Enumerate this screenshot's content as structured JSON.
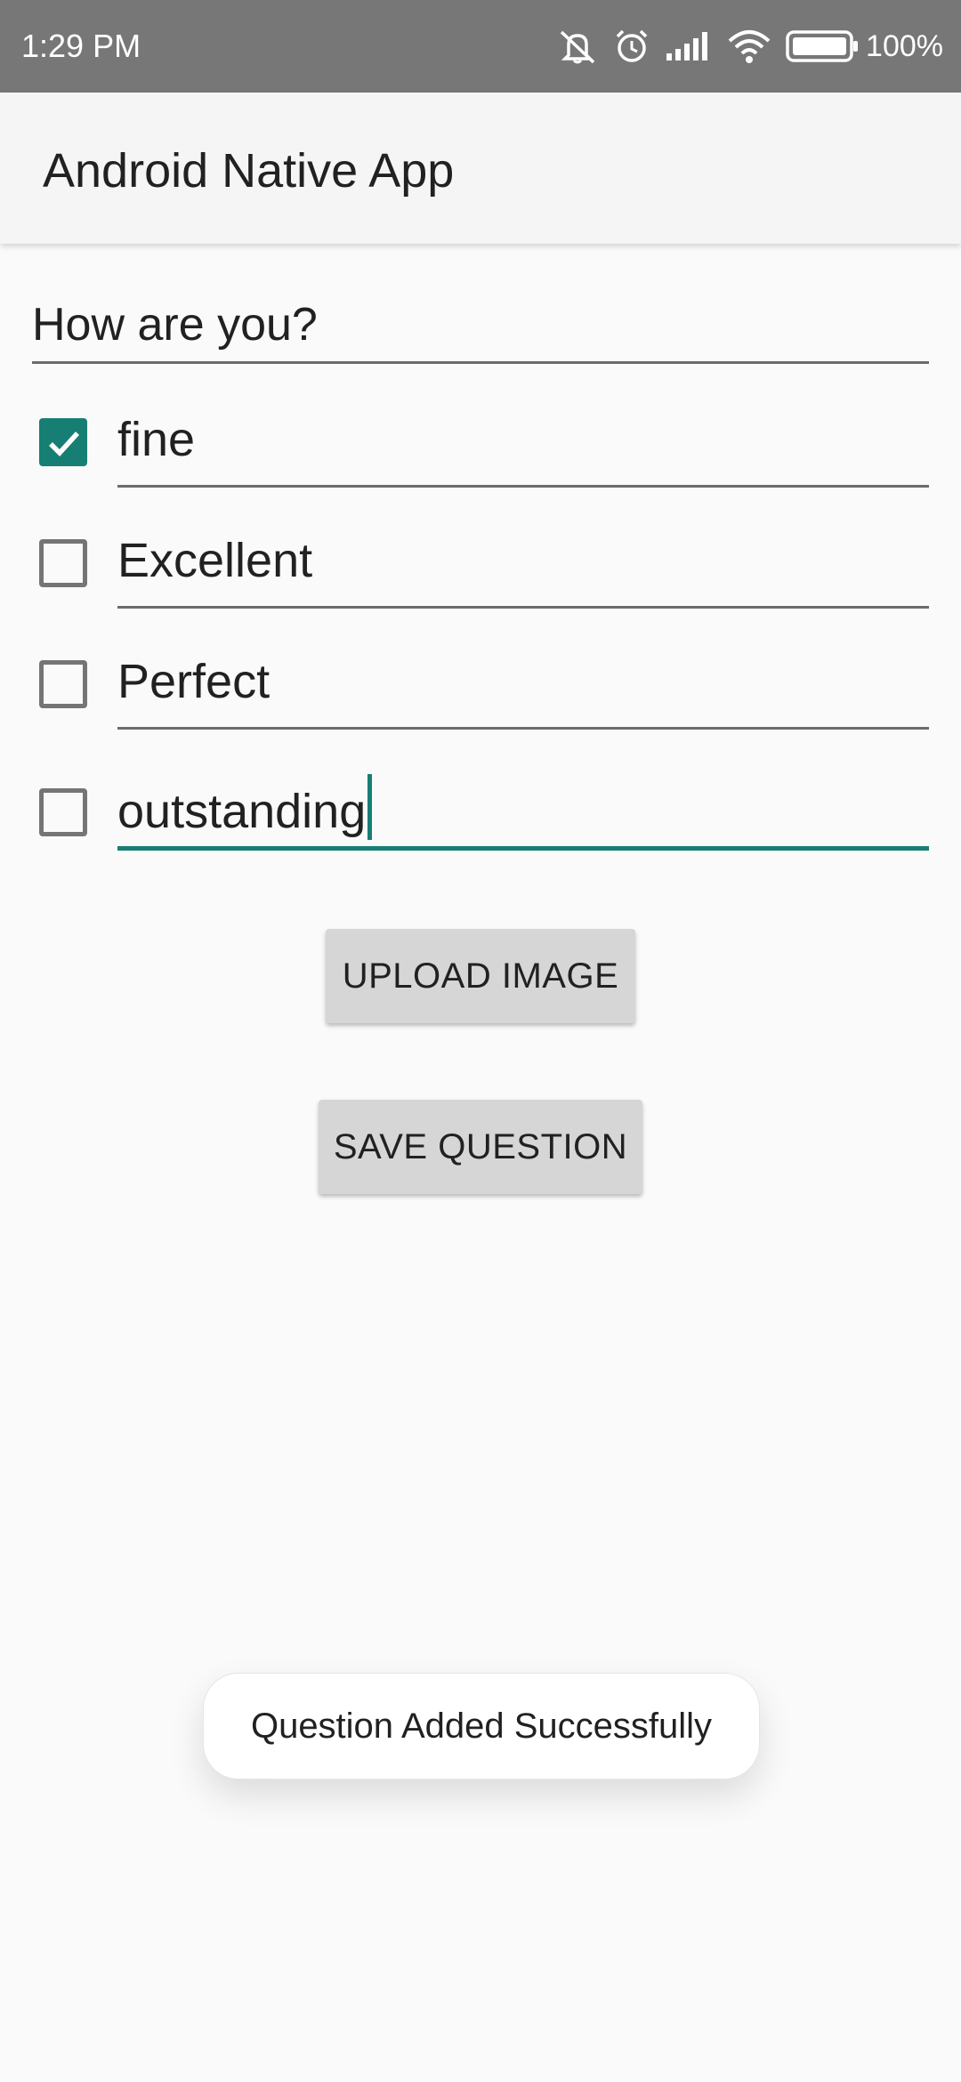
{
  "status_bar": {
    "time": "1:29 PM",
    "battery": "100%",
    "icons": [
      "muted-icon",
      "alarm-icon",
      "signal-icon",
      "wifi-icon",
      "battery-icon"
    ]
  },
  "app_bar": {
    "title": "Android Native App"
  },
  "form": {
    "question": "How are you?",
    "options": [
      {
        "text": "fine",
        "checked": true
      },
      {
        "text": "Excellent",
        "checked": false
      },
      {
        "text": "Perfect",
        "checked": false
      },
      {
        "text": "outstanding",
        "checked": false,
        "focused": true
      }
    ],
    "upload_label": "UPLOAD IMAGE",
    "save_label": "SAVE QUESTION"
  },
  "toast": {
    "message": "Question Added Successfully"
  },
  "colors": {
    "accent": "#177e73",
    "status_bar": "#777777",
    "app_bar": "#f5f5f5",
    "button": "#d6d6d6"
  }
}
